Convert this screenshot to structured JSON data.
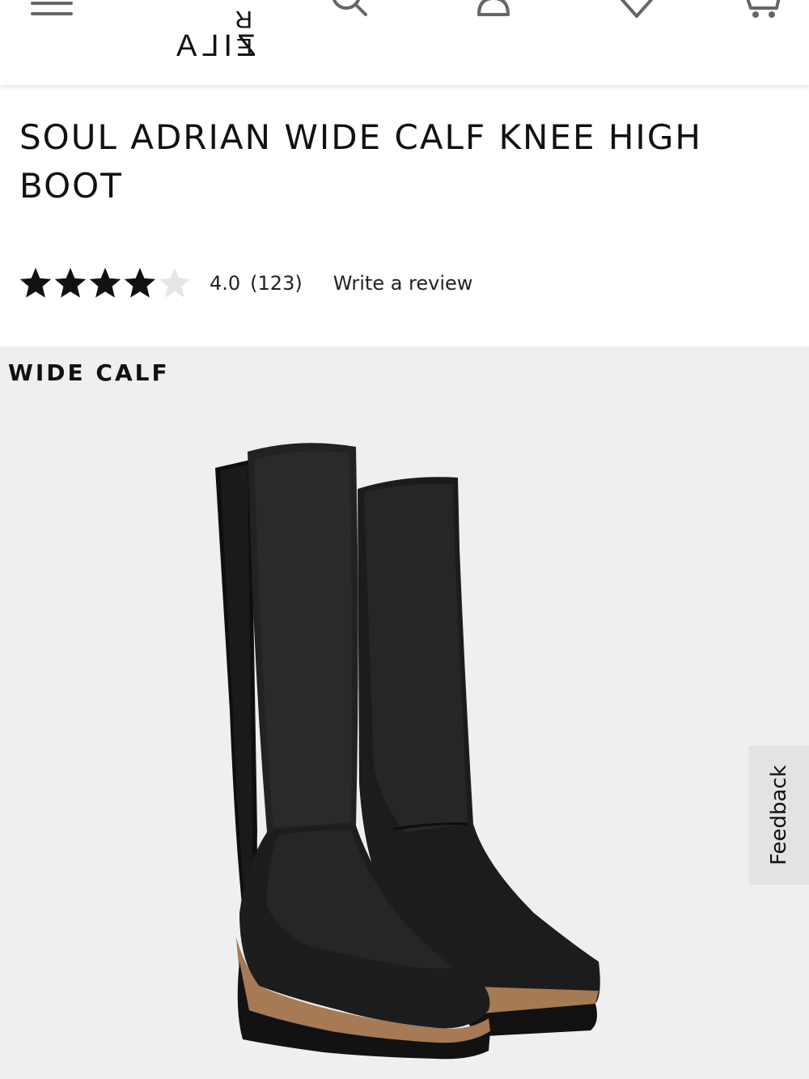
{
  "header": {
    "logo_line1": "E R",
    "logo_line2": "ZILA",
    "icons": [
      "menu-icon",
      "search-icon",
      "account-icon",
      "wishlist-icon",
      "cart-icon"
    ]
  },
  "product": {
    "title": "SOUL ADRIAN WIDE CALF KNEE HIGH BOOT",
    "rating": {
      "stars_filled": 4,
      "stars_total": 5,
      "value": "4.0",
      "count": "(123)",
      "write_review": "Write a review"
    },
    "badge": "WIDE CALF"
  },
  "feedback": {
    "label": "Feedback"
  },
  "colors": {
    "star_filled": "#111111",
    "star_empty": "#e6e6e6",
    "image_bg": "#efefef",
    "feedback_bg": "#e3e3e3"
  }
}
